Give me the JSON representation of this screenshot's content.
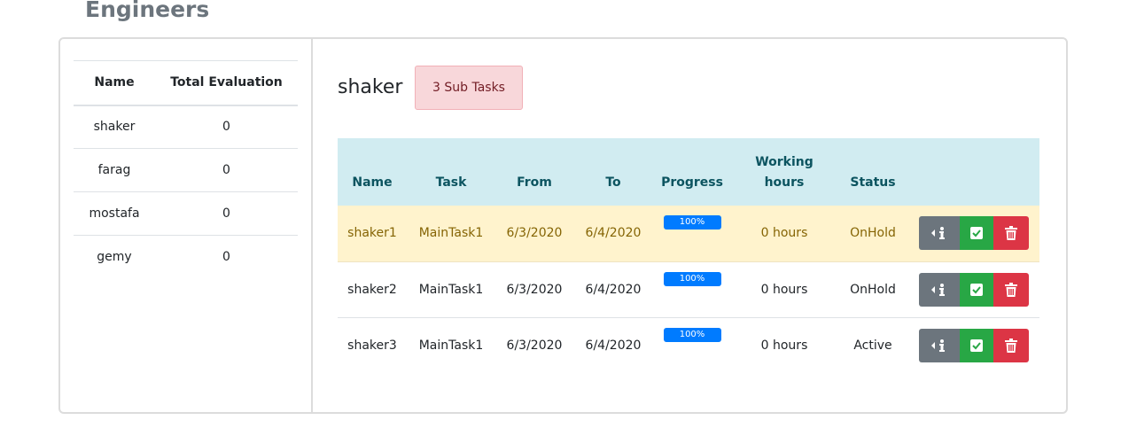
{
  "page": {
    "title": "Engineers"
  },
  "engineers": {
    "headers": {
      "name": "Name",
      "total": "Total Evaluation"
    },
    "rows": [
      {
        "name": "shaker",
        "total": "0"
      },
      {
        "name": "farag",
        "total": "0"
      },
      {
        "name": "mostafa",
        "total": "0"
      },
      {
        "name": "gemy",
        "total": "0"
      }
    ]
  },
  "detail": {
    "engineer_name": "shaker",
    "subtasks_badge": "3 Sub Tasks",
    "headers": {
      "name": "Name",
      "task": "Task",
      "from": "From",
      "to": "To",
      "progress": "Progress",
      "hours_line1": "Working",
      "hours_line2": "hours",
      "status": "Status"
    },
    "rows": [
      {
        "name": "shaker1",
        "task": "MainTask1",
        "from": "6/3/2020",
        "to": "6/4/2020",
        "progress": "100%",
        "progress_value": 1.0,
        "hours": "0 hours",
        "status": "OnHold"
      },
      {
        "name": "shaker2",
        "task": "MainTask1",
        "from": "6/3/2020",
        "to": "6/4/2020",
        "progress": "100%",
        "progress_value": 1.0,
        "hours": "0 hours",
        "status": "OnHold"
      },
      {
        "name": "shaker3",
        "task": "MainTask1",
        "from": "6/3/2020",
        "to": "6/4/2020",
        "progress": "100%",
        "progress_value": 1.0,
        "hours": "0 hours",
        "status": "Active"
      }
    ],
    "actions": [
      "info-icon",
      "check-icon",
      "trash-icon"
    ]
  },
  "colors": {
    "header_bg": "#d1ecf1",
    "highlight_row": "#fff3cd",
    "badge_bg": "#f8d7da",
    "progress": "#007bff",
    "info_btn": "#6c757d",
    "check_btn": "#28a745",
    "delete_btn": "#dc3545"
  }
}
